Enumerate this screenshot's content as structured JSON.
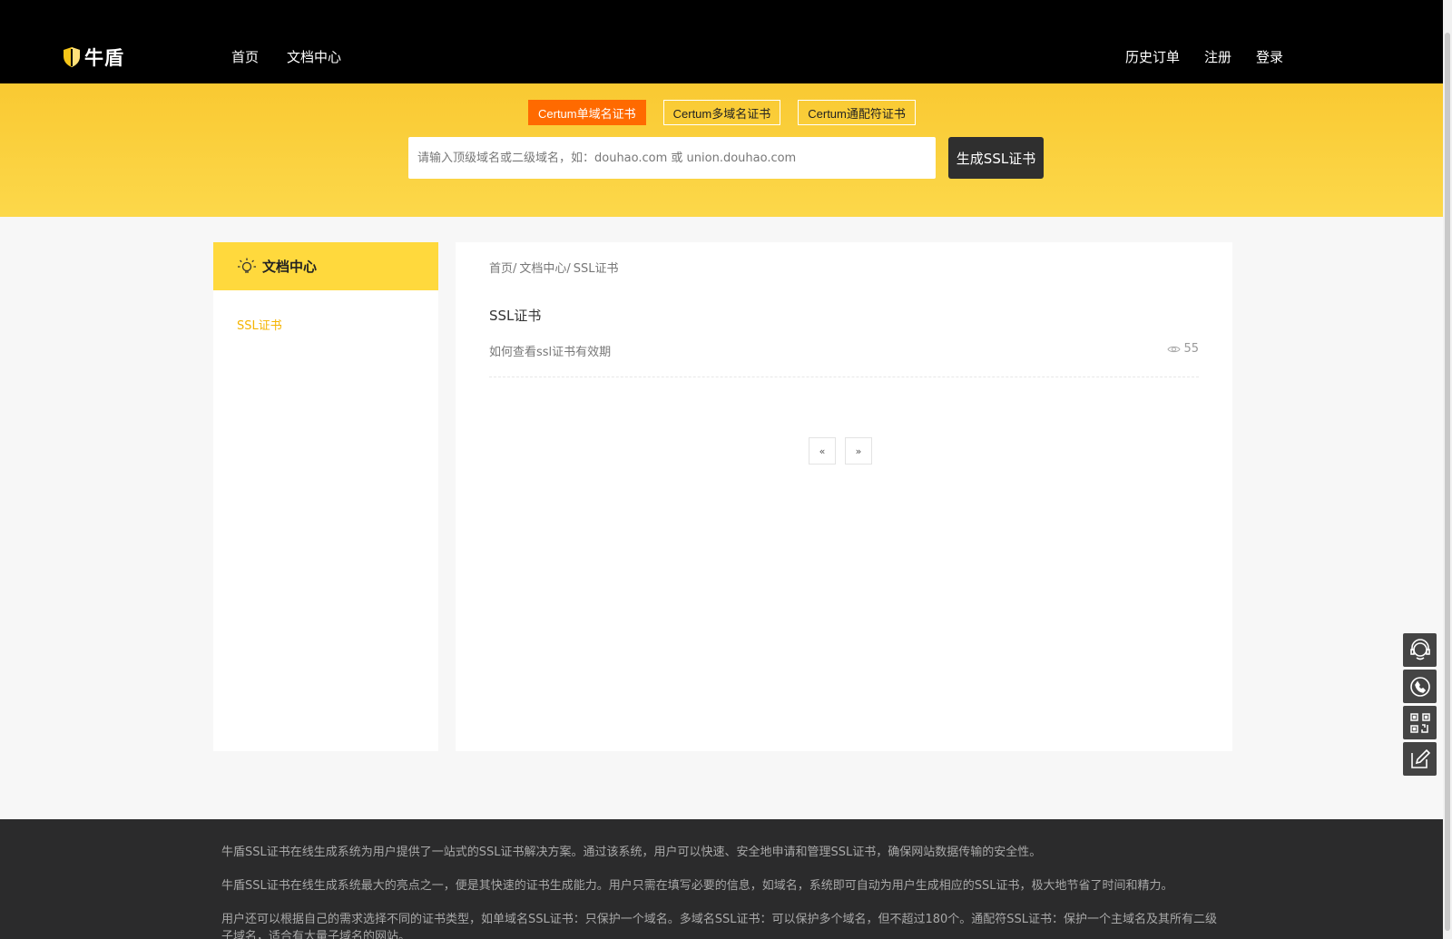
{
  "header": {
    "logo_text": "牛盾",
    "nav_left": [
      "首页",
      "文档中心"
    ],
    "nav_right": [
      "历史订单",
      "注册",
      "登录"
    ]
  },
  "hero": {
    "tabs": [
      "Certum单域名证书",
      "Certum多域名证书",
      "Certum通配符证书"
    ],
    "active_tab": 0,
    "search": {
      "value": "",
      "placeholder": "请输入顶级域名或二级域名，如：douhao.com 或 union.douhao.com"
    },
    "generate_label": "生成SSL证书"
  },
  "sidebar": {
    "title": "文档中心",
    "items": [
      {
        "label": "SSL证书"
      }
    ]
  },
  "main": {
    "breadcrumb": [
      "首页/",
      "文档中心/",
      "SSL证书"
    ],
    "title": "SSL证书",
    "articles": [
      {
        "title": "如何查看ssl证书有效期",
        "views": "55"
      }
    ],
    "pager": {
      "prev": "«",
      "next": "»"
    }
  },
  "footer": {
    "paragraphs": [
      "牛盾SSL证书在线生成系统为用户提供了一站式的SSL证书解决方案。通过该系统，用户可以快速、安全地申请和管理SSL证书，确保网站数据传输的安全性。",
      "牛盾SSL证书在线生成系统最大的亮点之一，便是其快速的证书生成能力。用户只需在填写必要的信息，如域名，系统即可自动为用户生成相应的SSL证书，极大地节省了时间和精力。",
      "用户还可以根据自己的需求选择不同的证书类型，如单域名SSL证书：只保护一个域名。多域名SSL证书：可以保护多个域名，但不超过180个。通配符SSL证书：保护一个主域名及其所有二级子域名，适合有大量子域名的网站。"
    ]
  },
  "colors": {
    "accent": "#ff6a00",
    "brand_yellow": "#ffd93d",
    "link_yellow": "#f5b400",
    "dark": "#2f2f2f"
  },
  "icons": {
    "logo": "shield-icon",
    "sidebar_head": "lightbulb-icon",
    "views": "eye-icon",
    "float_tools": [
      "customer-service-icon",
      "phone-icon",
      "qr-code-icon",
      "edit-icon"
    ]
  }
}
